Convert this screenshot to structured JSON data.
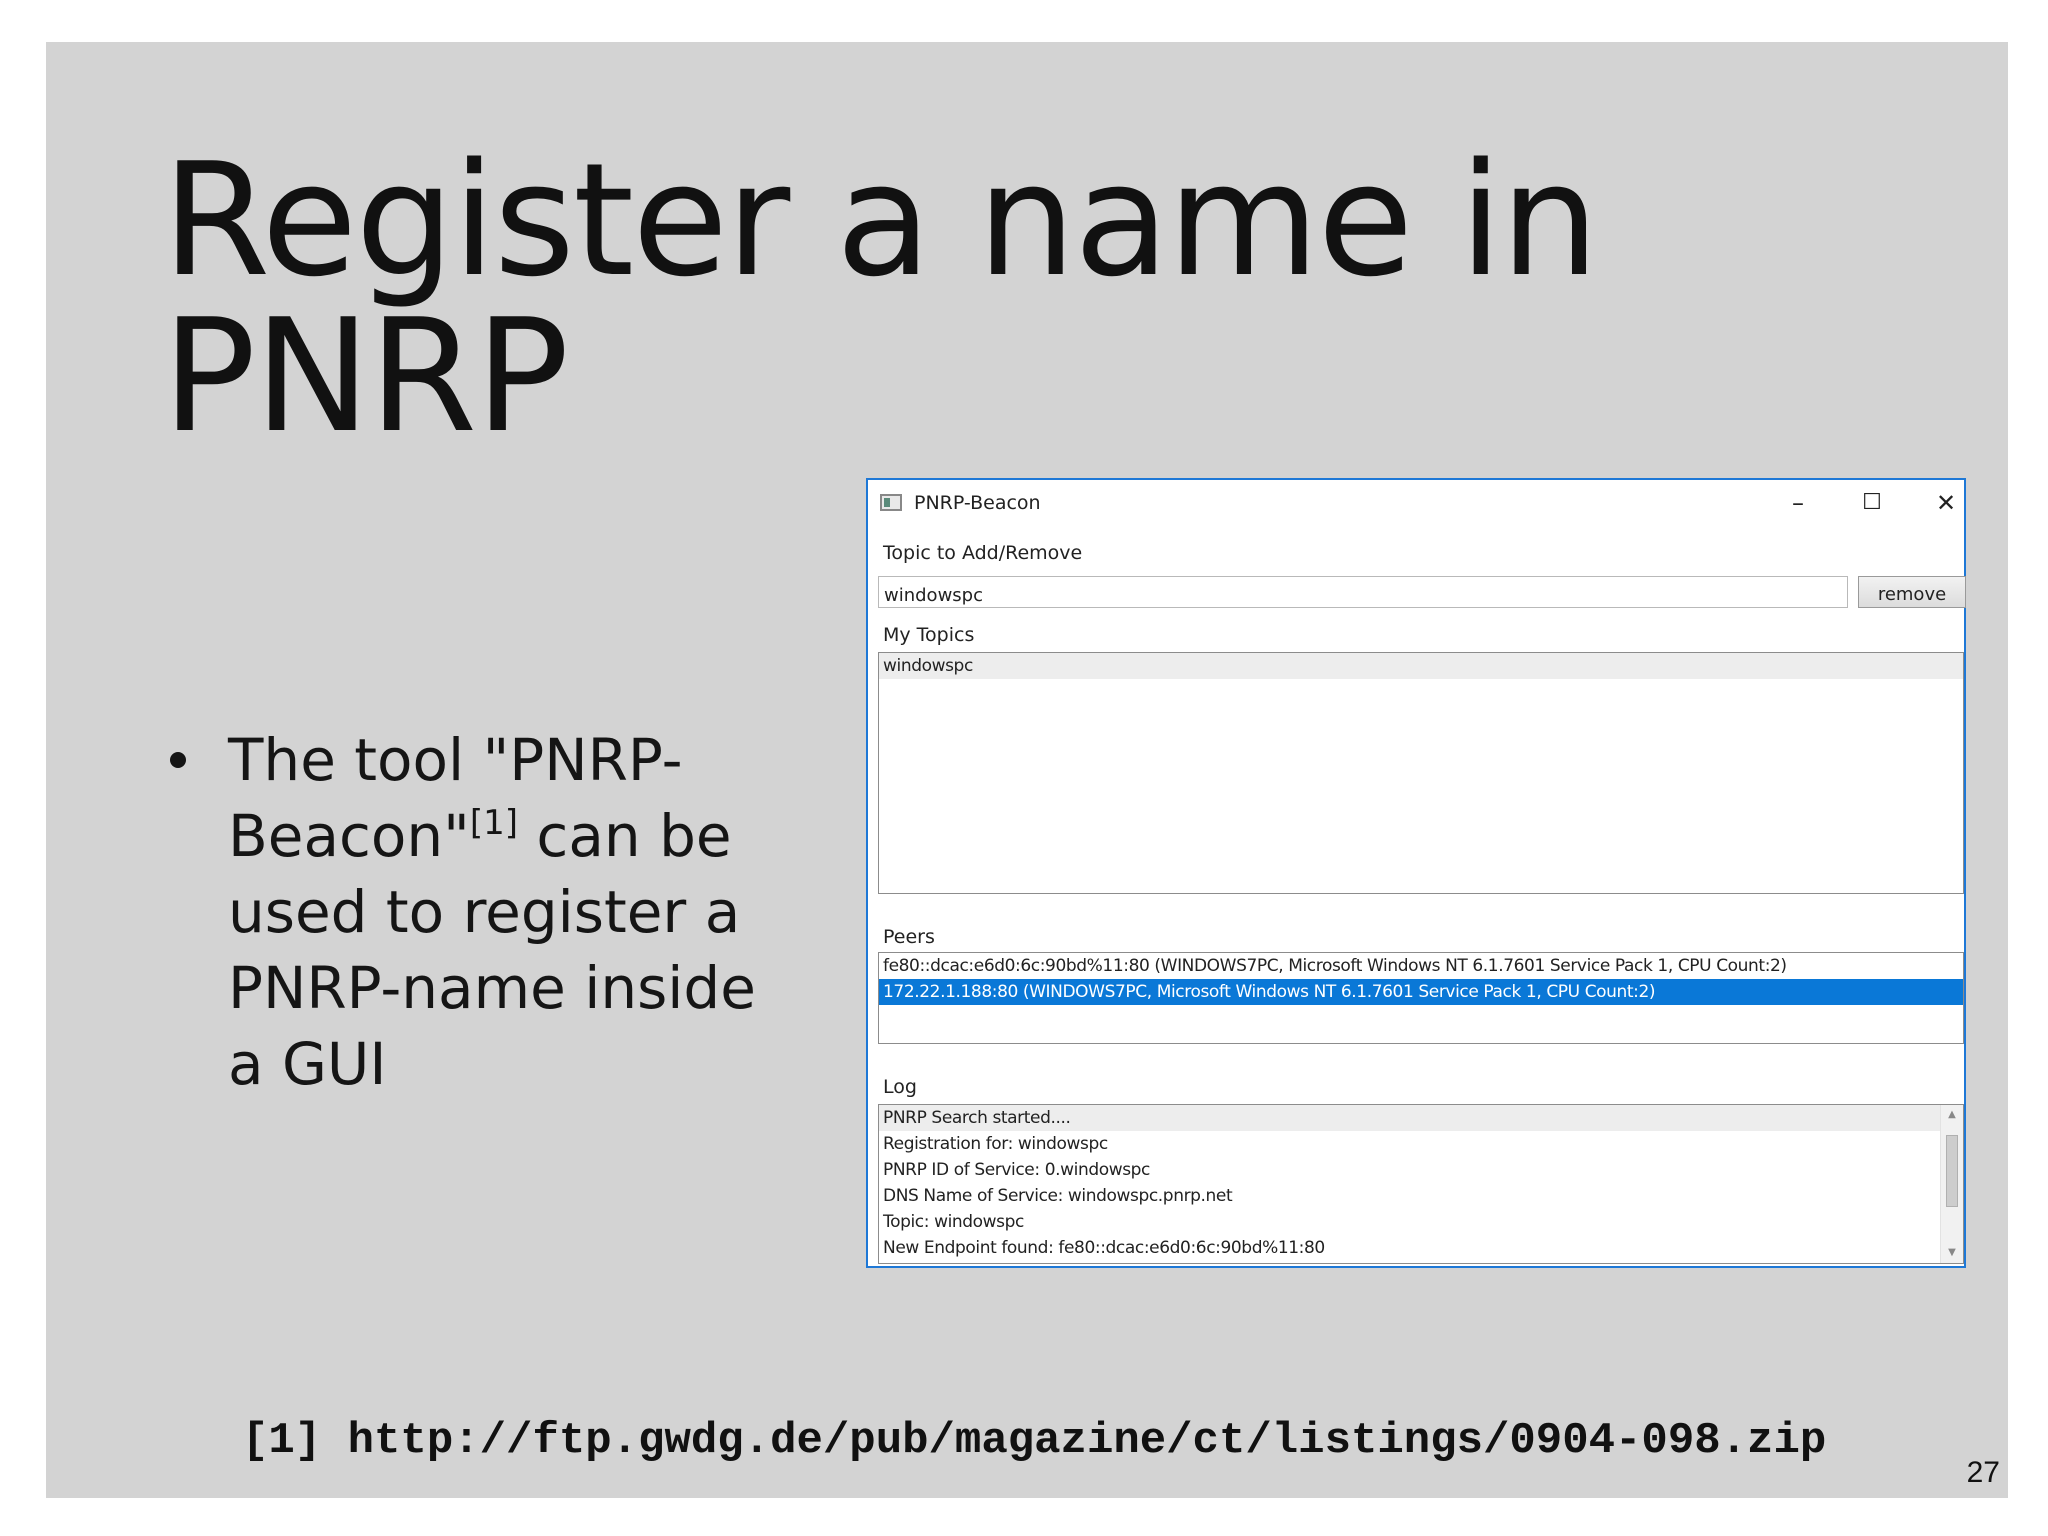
{
  "slide": {
    "title": "Register a name in PNRP",
    "bullet": {
      "text_before": "The tool \"PNRP-Beacon\"",
      "footref": "[1]",
      "text_after": " can be used to register a PNRP-name inside a GUI"
    },
    "footnote": "[1] http://ftp.gwdg.de/pub/magazine/ct/listings/0904-098.zip",
    "page_number": "27"
  },
  "window": {
    "title": "PNRP-Beacon",
    "controls": {
      "minimize": "–",
      "maximize": "☐",
      "close": "✕"
    },
    "topic_label": "Topic to Add/Remove",
    "topic_value": "windowspc",
    "remove_label": "remove",
    "my_topics_label": "My Topics",
    "my_topics": [
      "windowspc"
    ],
    "peers_label": "Peers",
    "peers": [
      "fe80::dcac:e6d0:6c:90bd%11:80 (WINDOWS7PC, Microsoft Windows NT 6.1.7601 Service Pack 1, CPU Count:2)",
      "172.22.1.188:80 (WINDOWS7PC, Microsoft Windows NT 6.1.7601 Service Pack 1, CPU Count:2)"
    ],
    "log_label": "Log",
    "log": [
      "PNRP Search started....",
      "Registration for: windowspc",
      "PNRP ID of Service: 0.windowspc",
      "DNS Name of Service: windowspc.pnrp.net",
      "Topic: windowspc",
      "New Endpoint found: fe80::dcac:e6d0:6c:90bd%11:80"
    ]
  }
}
